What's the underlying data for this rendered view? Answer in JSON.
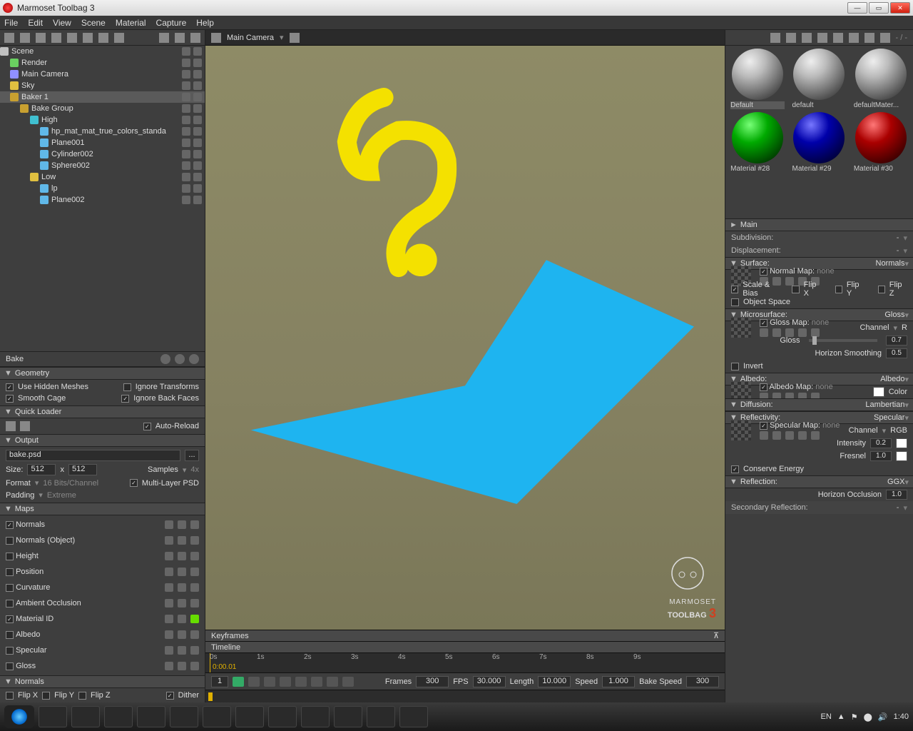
{
  "window": {
    "title": "Marmoset Toolbag 3"
  },
  "menus": [
    "File",
    "Edit",
    "View",
    "Scene",
    "Material",
    "Capture",
    "Help"
  ],
  "viewport": {
    "camera": "Main Camera",
    "logo1": "MARMOSET",
    "logo2": "TOOLBAG",
    "logo3": "3"
  },
  "tree": [
    {
      "pad": 0,
      "icon": "#c0c0c0",
      "label": "Scene",
      "lv": true
    },
    {
      "pad": 14,
      "icon": "#6ad060",
      "label": "Render",
      "lv": true
    },
    {
      "pad": 14,
      "icon": "#9090ff",
      "label": "Main Camera",
      "lv": true
    },
    {
      "pad": 14,
      "icon": "#e0c040",
      "label": "Sky",
      "lv": true
    },
    {
      "pad": 14,
      "icon": "#c8a030",
      "label": "Baker 1",
      "lv": true,
      "sel": true
    },
    {
      "pad": 28,
      "icon": "#c8a030",
      "label": "Bake Group",
      "lv": true
    },
    {
      "pad": 42,
      "icon": "#40c0d0",
      "label": "High",
      "lv": true
    },
    {
      "pad": 56,
      "icon": "#60b8e8",
      "label": "hp_mat_mat_true_colors_standa",
      "lv": true
    },
    {
      "pad": 56,
      "icon": "#60b8e8",
      "label": "Plane001",
      "lv": true
    },
    {
      "pad": 56,
      "icon": "#60b8e8",
      "label": "Cylinder002",
      "lv": true
    },
    {
      "pad": 56,
      "icon": "#60b8e8",
      "label": "Sphere002",
      "lv": true
    },
    {
      "pad": 42,
      "icon": "#e0c040",
      "label": "Low",
      "lv": true
    },
    {
      "pad": 56,
      "icon": "#60b8e8",
      "label": "lp",
      "lv": true
    },
    {
      "pad": 56,
      "icon": "#60b8e8",
      "label": "Plane002",
      "lv": true
    }
  ],
  "bake": {
    "tab": "Bake",
    "geometry": {
      "header": "Geometry",
      "useHidden": {
        "label": "Use Hidden Meshes",
        "on": true
      },
      "ignoreTrans": {
        "label": "Ignore Transforms",
        "on": false
      },
      "smoothCage": {
        "label": "Smooth Cage",
        "on": true
      },
      "ignoreBack": {
        "label": "Ignore Back Faces",
        "on": true
      }
    },
    "quick": {
      "header": "Quick Loader",
      "auto": {
        "label": "Auto-Reload",
        "on": true
      }
    },
    "output": {
      "header": "Output",
      "file": "bake.psd",
      "sizeLbl": "Size:",
      "w": "512",
      "x": "x",
      "h": "512",
      "samplesLbl": "Samples",
      "samplesMul": "4x",
      "formatLbl": "Format",
      "format": "16 Bits/Channel",
      "multi": {
        "label": "Multi-Layer PSD",
        "on": true
      },
      "paddingLbl": "Padding",
      "padding": "Extreme",
      "browse": "..."
    },
    "maps": {
      "header": "Maps",
      "items": [
        {
          "label": "Normals",
          "on": true
        },
        {
          "label": "Normals (Object)",
          "on": false
        },
        {
          "label": "Height",
          "on": false
        },
        {
          "label": "Position",
          "on": false
        },
        {
          "label": "Curvature",
          "on": false
        },
        {
          "label": "Ambient Occlusion",
          "on": false
        },
        {
          "label": "Material ID",
          "on": true,
          "hl": true
        },
        {
          "label": "Albedo",
          "on": false
        },
        {
          "label": "Specular",
          "on": false
        },
        {
          "label": "Gloss",
          "on": false
        }
      ],
      "normalsHdr": "Normals",
      "flipx": "Flip X",
      "flipy": "Flip Y",
      "flipz": "Flip Z",
      "dither": {
        "label": "Dither",
        "on": true
      }
    }
  },
  "materials": [
    {
      "name": "Default",
      "cls": "grey",
      "sel": true
    },
    {
      "name": "default",
      "cls": "grey"
    },
    {
      "name": "defaultMater...",
      "cls": "grey"
    },
    {
      "name": "Material #28",
      "cls": "green"
    },
    {
      "name": "Material #29",
      "cls": "blue"
    },
    {
      "name": "Material #30",
      "cls": "red"
    }
  ],
  "props": {
    "main": "Main",
    "subdiv": "Subdivision:",
    "disp": "Displacement:",
    "dash": "-",
    "surface": {
      "hdr": "Surface:",
      "mode": "Normals",
      "map": "Normal Map:",
      "none": "none",
      "scale": {
        "label": "Scale & Bias",
        "on": true
      },
      "fx": "Flip X",
      "fy": "Flip Y",
      "fz": "Flip Z",
      "obj": {
        "label": "Object Space",
        "on": false
      }
    },
    "micro": {
      "hdr": "Microsurface:",
      "mode": "Gloss",
      "map": "Gloss Map:",
      "none": "none",
      "chan": "Channel",
      "ch": "R",
      "gloss": "Gloss",
      "glossV": "0.7",
      "hs": "Horizon Smoothing",
      "hsV": "0.5",
      "inv": {
        "label": "Invert",
        "on": false
      }
    },
    "albedo": {
      "hdr": "Albedo:",
      "mode": "Albedo",
      "map": "Albedo Map:",
      "none": "none",
      "color": "Color"
    },
    "diff": {
      "hdr": "Diffusion:",
      "mode": "Lambertian"
    },
    "refl": {
      "hdr": "Reflectivity:",
      "mode": "Specular",
      "map": "Specular Map:",
      "none": "none",
      "chan": "Channel",
      "ch": "RGB",
      "int": "Intensity",
      "intV": "0.2",
      "fr": "Fresnel",
      "frV": "1.0",
      "cons": {
        "label": "Conserve Energy",
        "on": true
      }
    },
    "reflec": {
      "hdr": "Reflection:",
      "mode": "GGX",
      "ho": "Horizon Occlusion",
      "hoV": "1.0"
    },
    "secref": "Secondary Reflection:"
  },
  "timeline": {
    "kf": "Keyframes",
    "tl": "Timeline",
    "ticks": [
      "0s",
      "1s",
      "2s",
      "3s",
      "4s",
      "5s",
      "6s",
      "7s",
      "8s",
      "9s"
    ],
    "time": "0:00.01",
    "frame": "1",
    "framesLbl": "Frames",
    "frames": "300",
    "fpsLbl": "FPS",
    "fps": "30.000",
    "lenLbl": "Length",
    "len": "10.000",
    "spdLbl": "Speed",
    "spd": "1.000",
    "bspdLbl": "Bake Speed",
    "bspd": "300"
  },
  "sys": {
    "rinfo": "- / -",
    "lang": "EN",
    "clock": "1:40"
  }
}
